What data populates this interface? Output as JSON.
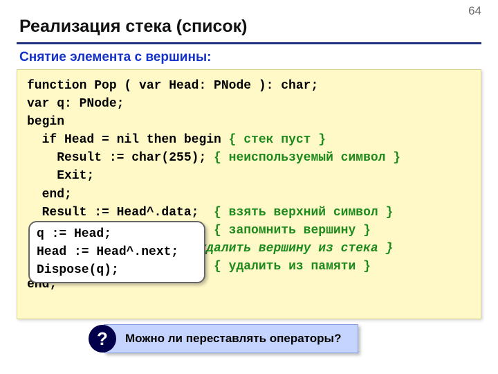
{
  "page_number": "64",
  "title": "Реализация стека (список)",
  "subtitle": "Снятие элемента с вершины:",
  "code": {
    "l1": "function Pop ( var Head: PNode ): char;",
    "l2": "var q: PNode;",
    "l3": "begin",
    "l4": "  if Head = nil then begin ",
    "c4": "{ стек пуст }",
    "l5": "    Result := char(255); ",
    "c5": "{ неиспользуемый символ }",
    "l6": "    Exit;",
    "l7": "  end;",
    "l8": "  Result := Head^.data;  ",
    "c8": "{ взять верхний символ }",
    "l9_spaces": "                         ",
    "c9": "{ запомнить вершину }",
    "l10_spaces": "                       ",
    "c10": "удалить вершину из стека }",
    "l11_spaces": "                         ",
    "c11": "{ удалить из памяти }",
    "l12": "end;"
  },
  "callout": {
    "l1": "q := Head;",
    "l2": "Head := Head^.next;",
    "l3": "Dispose(q);"
  },
  "question": {
    "badge": "?",
    "text": "Можно ли переставлять операторы?"
  }
}
